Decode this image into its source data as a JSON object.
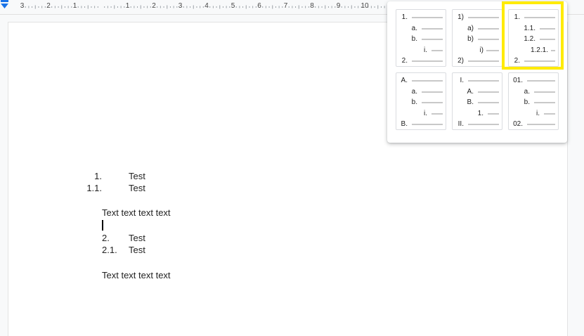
{
  "ruler": {
    "numbers": [
      "3",
      "2",
      "1",
      "1",
      "2",
      "3",
      "4",
      "5",
      "6",
      "7",
      "8",
      "9",
      "10"
    ]
  },
  "document": {
    "list1": [
      {
        "num": "1.",
        "text": "Test"
      },
      {
        "num": "1.1.",
        "text": "Test"
      }
    ],
    "para1": "Text text text text",
    "list2": [
      {
        "num": "2.",
        "text": "Test"
      },
      {
        "num": "2.1.",
        "text": "Test"
      }
    ],
    "para2": "Text text text text"
  },
  "list_presets": [
    {
      "id": "decimal-alpha-roman",
      "labels": [
        "1.",
        "a.",
        "b.",
        "i.",
        "2."
      ]
    },
    {
      "id": "paren-decimal",
      "labels": [
        "1)",
        "a)",
        "b)",
        "i)",
        "2)"
      ]
    },
    {
      "id": "multilevel-decimal",
      "labels": [
        "1.",
        "1.1.",
        "1.2.",
        "1.2.1.",
        "2."
      ],
      "highlighted": true
    },
    {
      "id": "upper-alpha",
      "labels": [
        "A.",
        "a.",
        "b.",
        "i.",
        "B."
      ]
    },
    {
      "id": "upper-roman",
      "labels": [
        "I.",
        "A.",
        "B.",
        "1.",
        "II."
      ]
    },
    {
      "id": "zero-padded",
      "labels": [
        "01.",
        "a.",
        "b.",
        "i.",
        "02."
      ]
    }
  ],
  "colors": {
    "highlight": "#ffeb00",
    "indent_marker": "#1a73e8"
  }
}
